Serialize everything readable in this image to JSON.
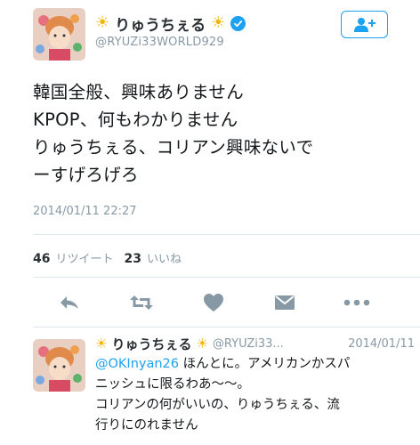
{
  "tweet": {
    "display_name": "りゅうちぇる",
    "handle": "@RYUZi33WORLD929",
    "text_lines": [
      "韓国全般、興味ありません",
      "KPOP、何もわかりません",
      "りゅうちぇる、コリアン興味ないで",
      "ーすげろげろ"
    ],
    "timestamp": "2014/01/11 22:27"
  },
  "stats": {
    "retweet_count": "46",
    "retweet_label": "リツイート",
    "like_count": "23",
    "like_label": "いいね"
  },
  "icons": {
    "sun": "☀",
    "verified": "verified-badge-icon",
    "follow": "add-user-icon",
    "reply": "reply-icon",
    "retweet": "retweet-icon",
    "like": "heart-icon",
    "dm": "envelope-icon",
    "more": "more-icon"
  },
  "reply": {
    "display_name": "りゅうちぇる",
    "handle": "@RYUZi33...",
    "date": "2014/01/11",
    "mention": "@OKInyan26",
    "line1_rest": " ほんとに。アメリカンかスパ",
    "lines": [
      "ニッシュに限るわあ～～。",
      "コリアンの何がいいの、りゅうちぇる、流",
      "行りにのれません"
    ]
  },
  "colors": {
    "accent": "#1da1f2",
    "secondary_text": "#8899a6",
    "icon_gray": "#8899a6",
    "sun": "#f5b400"
  }
}
